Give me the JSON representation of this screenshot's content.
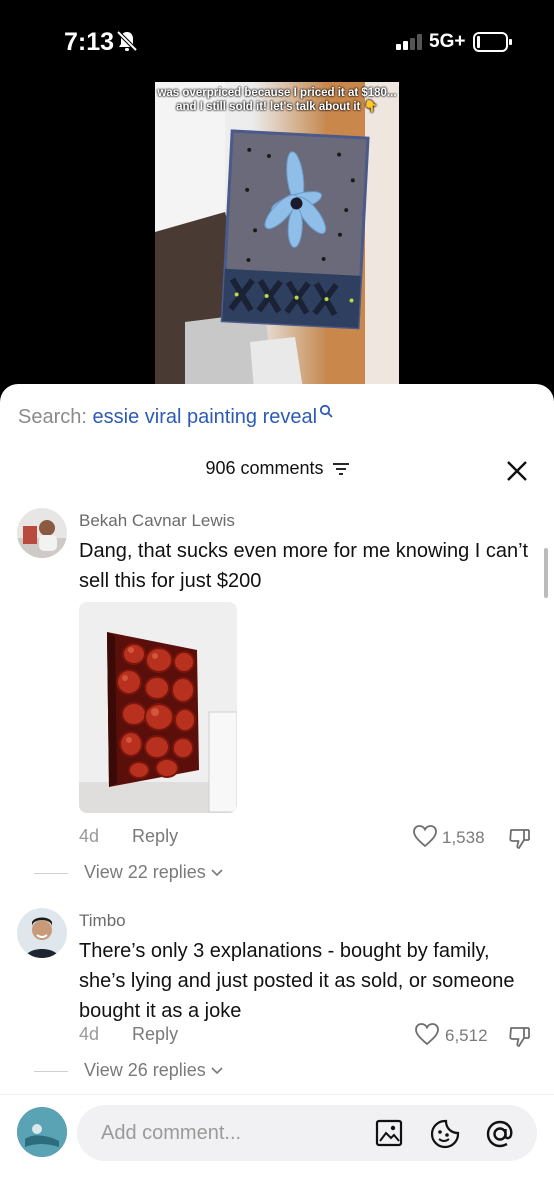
{
  "status_bar": {
    "time": "7:13",
    "network": "5G+"
  },
  "video": {
    "caption": "was overpriced because I priced it at $180... and I still sold it! let's talk about it 👇"
  },
  "search": {
    "prefix": "Search:",
    "term": "essie viral painting reveal"
  },
  "comments_header": {
    "count_label": "906 comments"
  },
  "comments": [
    {
      "username": "Bekah Cavnar Lewis",
      "text": "Dang, that sucks even more for me knowing I can’t sell this for just $200",
      "age": "4d",
      "reply_label": "Reply",
      "likes": "1,538",
      "view_replies": "View 22 replies"
    },
    {
      "username": "Timbo",
      "text": "There’s only 3 explanations - bought by family, she’s lying and just posted it as sold, or someone bought it as a joke",
      "age": "4d",
      "reply_label": "Reply",
      "likes": "6,512",
      "view_replies": "View 26 replies"
    }
  ],
  "composer": {
    "placeholder": "Add comment..."
  },
  "icons": [
    "bell-off-icon",
    "signal-icon",
    "battery-icon",
    "search-icon",
    "filter-icon",
    "close-icon",
    "heart-icon",
    "dislike-icon",
    "chevron-down-icon",
    "image-icon",
    "sticker-icon",
    "at-icon"
  ],
  "colors": {
    "search_term": "#2c5bb5",
    "text": "#111111",
    "muted": "#7a7a7a"
  }
}
